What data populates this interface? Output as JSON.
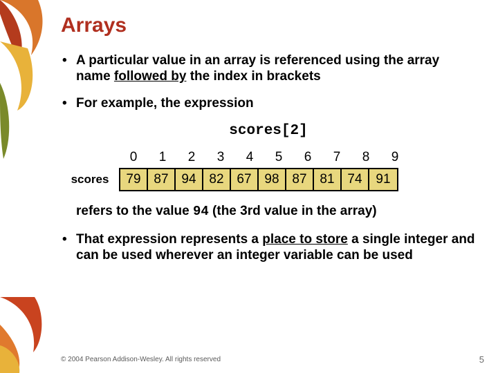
{
  "title": "Arrays",
  "bullets": {
    "b1_pre": "A particular value in an array is referenced using the array name ",
    "b1_underline": "followed by",
    "b1_post": " the index in brackets",
    "b2": "For example, the expression",
    "b3_pre": "That expression represents a ",
    "b3_underline": "place to store",
    "b3_post": " a single integer and can be used wherever an integer variable can be used"
  },
  "expression": "scores[2]",
  "array": {
    "label": "scores",
    "indices": [
      "0",
      "1",
      "2",
      "3",
      "4",
      "5",
      "6",
      "7",
      "8",
      "9"
    ],
    "values": [
      "79",
      "87",
      "94",
      "82",
      "67",
      "98",
      "87",
      "81",
      "74",
      "91"
    ]
  },
  "refers": {
    "pre": "refers to the value ",
    "code": "94",
    "post": " (the 3rd value in the array)"
  },
  "footer": "© 2004 Pearson Addison-Wesley. All rights reserved",
  "page": "5",
  "chart_data": {
    "type": "table",
    "title": "scores array",
    "categories": [
      "0",
      "1",
      "2",
      "3",
      "4",
      "5",
      "6",
      "7",
      "8",
      "9"
    ],
    "values": [
      79,
      87,
      94,
      82,
      67,
      98,
      87,
      81,
      74,
      91
    ]
  }
}
